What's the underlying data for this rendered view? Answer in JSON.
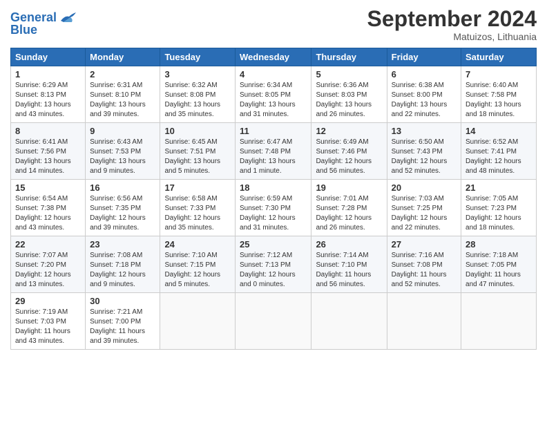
{
  "header": {
    "logo_text_general": "General",
    "logo_text_blue": "Blue",
    "month_title": "September 2024",
    "location": "Matuizos, Lithuania"
  },
  "weekdays": [
    "Sunday",
    "Monday",
    "Tuesday",
    "Wednesday",
    "Thursday",
    "Friday",
    "Saturday"
  ],
  "weeks": [
    [
      {
        "day": "1",
        "info": "Sunrise: 6:29 AM\nSunset: 8:13 PM\nDaylight: 13 hours\nand 43 minutes."
      },
      {
        "day": "2",
        "info": "Sunrise: 6:31 AM\nSunset: 8:10 PM\nDaylight: 13 hours\nand 39 minutes."
      },
      {
        "day": "3",
        "info": "Sunrise: 6:32 AM\nSunset: 8:08 PM\nDaylight: 13 hours\nand 35 minutes."
      },
      {
        "day": "4",
        "info": "Sunrise: 6:34 AM\nSunset: 8:05 PM\nDaylight: 13 hours\nand 31 minutes."
      },
      {
        "day": "5",
        "info": "Sunrise: 6:36 AM\nSunset: 8:03 PM\nDaylight: 13 hours\nand 26 minutes."
      },
      {
        "day": "6",
        "info": "Sunrise: 6:38 AM\nSunset: 8:00 PM\nDaylight: 13 hours\nand 22 minutes."
      },
      {
        "day": "7",
        "info": "Sunrise: 6:40 AM\nSunset: 7:58 PM\nDaylight: 13 hours\nand 18 minutes."
      }
    ],
    [
      {
        "day": "8",
        "info": "Sunrise: 6:41 AM\nSunset: 7:56 PM\nDaylight: 13 hours\nand 14 minutes."
      },
      {
        "day": "9",
        "info": "Sunrise: 6:43 AM\nSunset: 7:53 PM\nDaylight: 13 hours\nand 9 minutes."
      },
      {
        "day": "10",
        "info": "Sunrise: 6:45 AM\nSunset: 7:51 PM\nDaylight: 13 hours\nand 5 minutes."
      },
      {
        "day": "11",
        "info": "Sunrise: 6:47 AM\nSunset: 7:48 PM\nDaylight: 13 hours\nand 1 minute."
      },
      {
        "day": "12",
        "info": "Sunrise: 6:49 AM\nSunset: 7:46 PM\nDaylight: 12 hours\nand 56 minutes."
      },
      {
        "day": "13",
        "info": "Sunrise: 6:50 AM\nSunset: 7:43 PM\nDaylight: 12 hours\nand 52 minutes."
      },
      {
        "day": "14",
        "info": "Sunrise: 6:52 AM\nSunset: 7:41 PM\nDaylight: 12 hours\nand 48 minutes."
      }
    ],
    [
      {
        "day": "15",
        "info": "Sunrise: 6:54 AM\nSunset: 7:38 PM\nDaylight: 12 hours\nand 43 minutes."
      },
      {
        "day": "16",
        "info": "Sunrise: 6:56 AM\nSunset: 7:35 PM\nDaylight: 12 hours\nand 39 minutes."
      },
      {
        "day": "17",
        "info": "Sunrise: 6:58 AM\nSunset: 7:33 PM\nDaylight: 12 hours\nand 35 minutes."
      },
      {
        "day": "18",
        "info": "Sunrise: 6:59 AM\nSunset: 7:30 PM\nDaylight: 12 hours\nand 31 minutes."
      },
      {
        "day": "19",
        "info": "Sunrise: 7:01 AM\nSunset: 7:28 PM\nDaylight: 12 hours\nand 26 minutes."
      },
      {
        "day": "20",
        "info": "Sunrise: 7:03 AM\nSunset: 7:25 PM\nDaylight: 12 hours\nand 22 minutes."
      },
      {
        "day": "21",
        "info": "Sunrise: 7:05 AM\nSunset: 7:23 PM\nDaylight: 12 hours\nand 18 minutes."
      }
    ],
    [
      {
        "day": "22",
        "info": "Sunrise: 7:07 AM\nSunset: 7:20 PM\nDaylight: 12 hours\nand 13 minutes."
      },
      {
        "day": "23",
        "info": "Sunrise: 7:08 AM\nSunset: 7:18 PM\nDaylight: 12 hours\nand 9 minutes."
      },
      {
        "day": "24",
        "info": "Sunrise: 7:10 AM\nSunset: 7:15 PM\nDaylight: 12 hours\nand 5 minutes."
      },
      {
        "day": "25",
        "info": "Sunrise: 7:12 AM\nSunset: 7:13 PM\nDaylight: 12 hours\nand 0 minutes."
      },
      {
        "day": "26",
        "info": "Sunrise: 7:14 AM\nSunset: 7:10 PM\nDaylight: 11 hours\nand 56 minutes."
      },
      {
        "day": "27",
        "info": "Sunrise: 7:16 AM\nSunset: 7:08 PM\nDaylight: 11 hours\nand 52 minutes."
      },
      {
        "day": "28",
        "info": "Sunrise: 7:18 AM\nSunset: 7:05 PM\nDaylight: 11 hours\nand 47 minutes."
      }
    ],
    [
      {
        "day": "29",
        "info": "Sunrise: 7:19 AM\nSunset: 7:03 PM\nDaylight: 11 hours\nand 43 minutes."
      },
      {
        "day": "30",
        "info": "Sunrise: 7:21 AM\nSunset: 7:00 PM\nDaylight: 11 hours\nand 39 minutes."
      },
      {
        "day": "",
        "info": ""
      },
      {
        "day": "",
        "info": ""
      },
      {
        "day": "",
        "info": ""
      },
      {
        "day": "",
        "info": ""
      },
      {
        "day": "",
        "info": ""
      }
    ]
  ]
}
